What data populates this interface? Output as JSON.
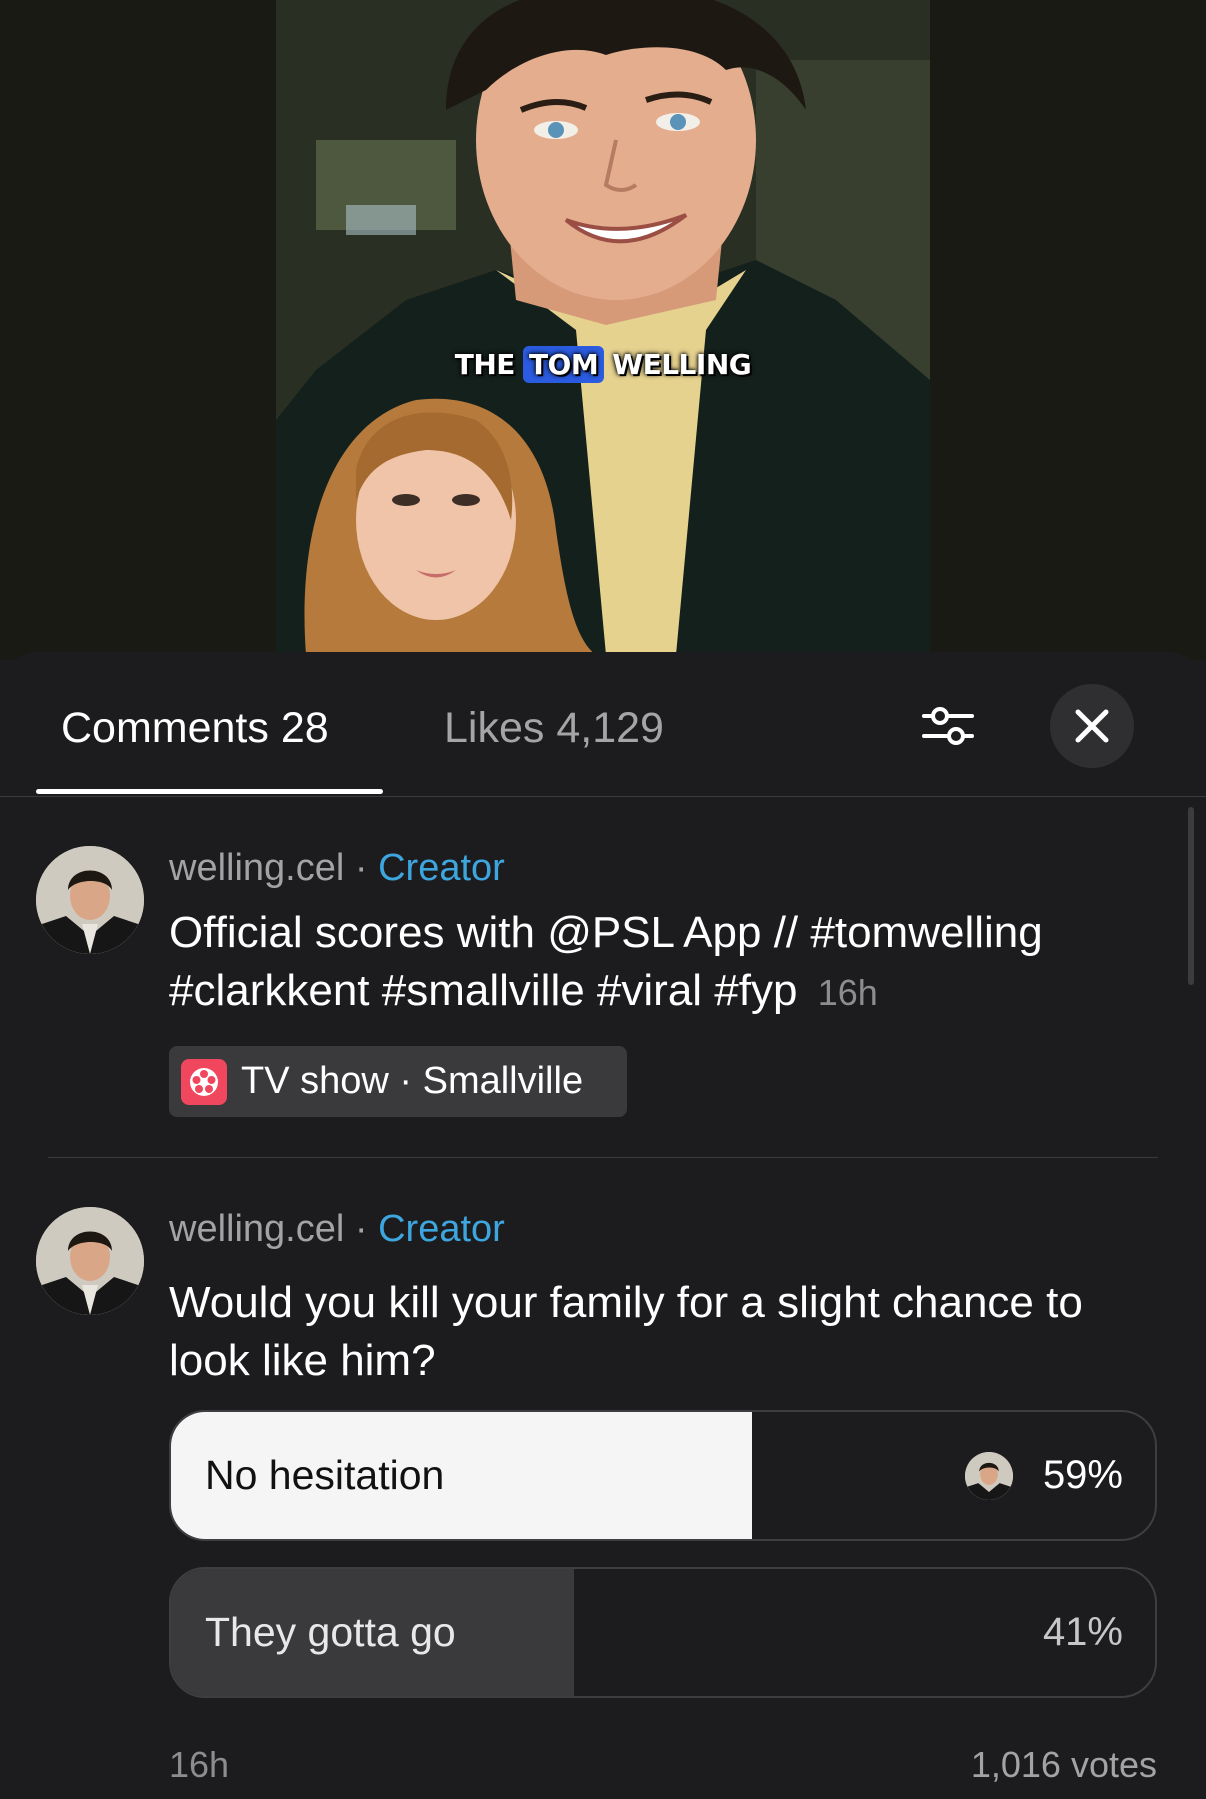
{
  "video": {
    "caption_before": "THE",
    "caption_highlight": "TOM",
    "caption_after": "WELLING"
  },
  "tabs": {
    "comments_label": "Comments 28",
    "likes_label": "Likes 4,129"
  },
  "icons": {
    "filter": "sliders-icon",
    "close": "close-icon",
    "chip": "film-reel-icon"
  },
  "comments": [
    {
      "username": "welling.cel",
      "separator": "·",
      "badge": "Creator",
      "text": "Official scores with @PSL App // #tomwelling #clarkkent #smallville #viral #fyp",
      "time": "16h",
      "chip": "TV show · Smallville"
    },
    {
      "username": "welling.cel",
      "separator": "·",
      "badge": "Creator",
      "text": "Would you kill your family for a slight chance to look like him?",
      "poll": {
        "options": [
          {
            "label": "No hesitation",
            "percent_text": "59%",
            "fraction": 0.59,
            "selected": true
          },
          {
            "label": "They gotta go",
            "percent_text": "41%",
            "fraction": 0.41,
            "selected": false
          }
        ],
        "time": "16h",
        "votes": "1,016 votes"
      }
    }
  ],
  "colors": {
    "background": "#1c1c1e",
    "creator_badge": "#3ea6de",
    "chip_icon": "#f0475e",
    "caption_highlight": "#2b5be0"
  }
}
